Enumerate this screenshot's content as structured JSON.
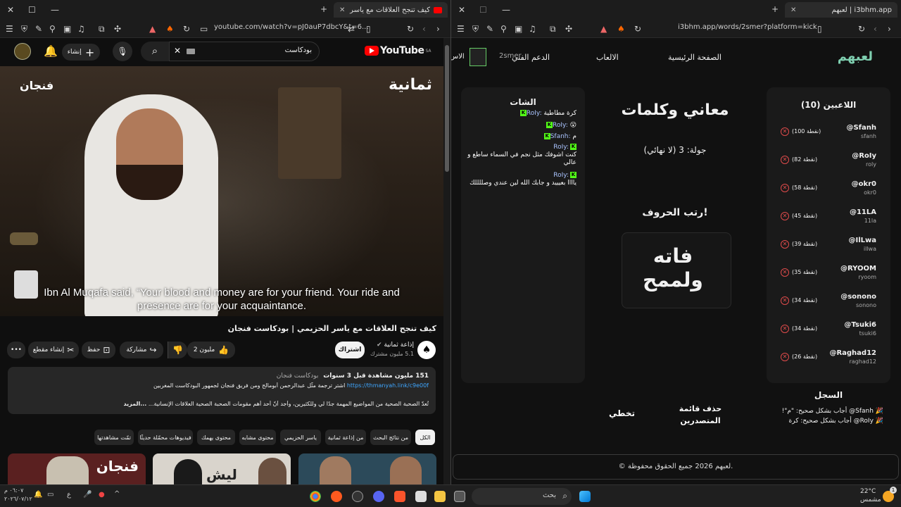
{
  "left_window": {
    "tab_title": "كيف تنجح العلاقات مع ياسر الحز",
    "url": "youtube.com/watch?v=pJ0auP7dbcY&t=6...",
    "youtube": {
      "logo": "YouTube",
      "region": "SA",
      "search_value": "بودكاست",
      "create_label": "إنشاء",
      "notification_count": "",
      "video": {
        "channel_overlay": "ثمانية",
        "show_overlay": "فنجان",
        "subtitle": "Ibn Al Muqafa said, “Your blood and money are for your friend. Your ride and presence are for your acquaintance."
      },
      "title": "كيف تنجح العلاقات مع ياسر الحزيمي | بودكاست فنجان",
      "channel_name": "إذاعة ثمانية",
      "subscribers": "5.1 مليون مشترك",
      "subscribe_label": "اشتراك",
      "likes": "2 مليون",
      "share_label": "مشاركة",
      "save_label": "حفظ",
      "clip_label": "إنشاء مقطع",
      "description": {
        "stats": "151 مليون مشاهدة قبل 3 سنوات",
        "tag": "بودكاست فنجان",
        "line1_link": "https://thmanyah.link/c9e00f",
        "line1_text": "اشترِ ترجمة مثّل عبدالرحمن أبومالح ومن فريق فنجان لجمهور البودكاست المغربين",
        "line2": "تُعدّ الصحبة الصحية من المواضيع المهمة جدًا لي وللكثيرين، وأجد أنّ أحد أهم مقومات الصحبة الصحية العلاقات الإنسانية...",
        "more": "...المزيد"
      },
      "chips": [
        "الكل",
        "من نتائج البحث",
        "من إذاعة ثمانية",
        "ياسر الحزيمي",
        "محتوى مشابه",
        "محتوى يهمك",
        "فيديوهات محمّلة حديثًا",
        "تمّت مشاهدتها"
      ],
      "thumbnails": [
        {
          "text": "فنجان"
        },
        {
          "text": "ليش"
        },
        {
          "text": ""
        }
      ]
    }
  },
  "right_window": {
    "tab_title": "لعبهم | i3bhm.app",
    "url": "i3bhm.app/words/2smer?platform=kick",
    "nav": {
      "logo": "لعبهم",
      "home": "الصفحة الرئيسية",
      "games": "الالعاب",
      "support": "الدعم الفني",
      "user": "2smer",
      "extra": "الاس"
    },
    "players": {
      "title": "اللاعبين (10)",
      "list": [
        {
          "name": "@Sfanh",
          "sub": "sfanh",
          "points": "(100 نقطة)"
        },
        {
          "name": "@RoIy",
          "sub": "roly",
          "points": "(82 نقطة)"
        },
        {
          "name": "@okr0",
          "sub": "okr0",
          "points": "(58 نقطة)"
        },
        {
          "name": "@11LA",
          "sub": "11la",
          "points": "(45 نقطة)"
        },
        {
          "name": "@IlLwa",
          "sub": "illwa",
          "points": "(39 نقطة)"
        },
        {
          "name": "@RYOOM",
          "sub": "ryoom",
          "points": "(35 نقطة)"
        },
        {
          "name": "@sonono",
          "sub": "sonono",
          "points": "(34 نقطة)"
        },
        {
          "name": "@Tsuki6",
          "sub": "tsuki6",
          "points": "(34 نقطة)"
        },
        {
          "name": "@Raghad12",
          "sub": "raghad12",
          "points": "(26 نقطة)"
        }
      ]
    },
    "game": {
      "title": "معاني وكلمات",
      "round": "جولة: 3 (لا نهائي)",
      "instruction": "رتب الحروف!",
      "scrambled": "فاته ولممح",
      "skip": "تخطي",
      "clear_leaderboard": "حذف قائمة المتصدرين"
    },
    "chat": {
      "title": "الشات",
      "messages": [
        {
          "user": "RoIy:",
          "text": "كرة مطاطية"
        },
        {
          "user": "RoIy:",
          "text": "😮"
        },
        {
          "user": "Sfanh:",
          "text": "م"
        },
        {
          "user": "RoIy:",
          "text": "كنت اشوفك مثل نجم في السماء ساطع و عالي"
        },
        {
          "user": "RoIy:",
          "text": "ياااا بعيييد و جابك الله لين عندي وصللللك"
        }
      ]
    },
    "log": {
      "title": "السجل",
      "entries": [
        "🎉 Sfanh@ أجاب بشكل صحيح: \"م\"!",
        "🎉 RoIy@ أجاب بشكل صحيح: كرة"
      ]
    },
    "footer": "© لعبهم 2026 جميع الحقوق محفوظة."
  },
  "taskbar": {
    "weather_temp": "22°C",
    "weather_text": "مشمس",
    "search_placeholder": "بحث",
    "time": "٠٦:٠٧ م",
    "date": "٢٠٢٦/٠٧/١٢",
    "lang": "ع",
    "notification_badge": "1"
  }
}
